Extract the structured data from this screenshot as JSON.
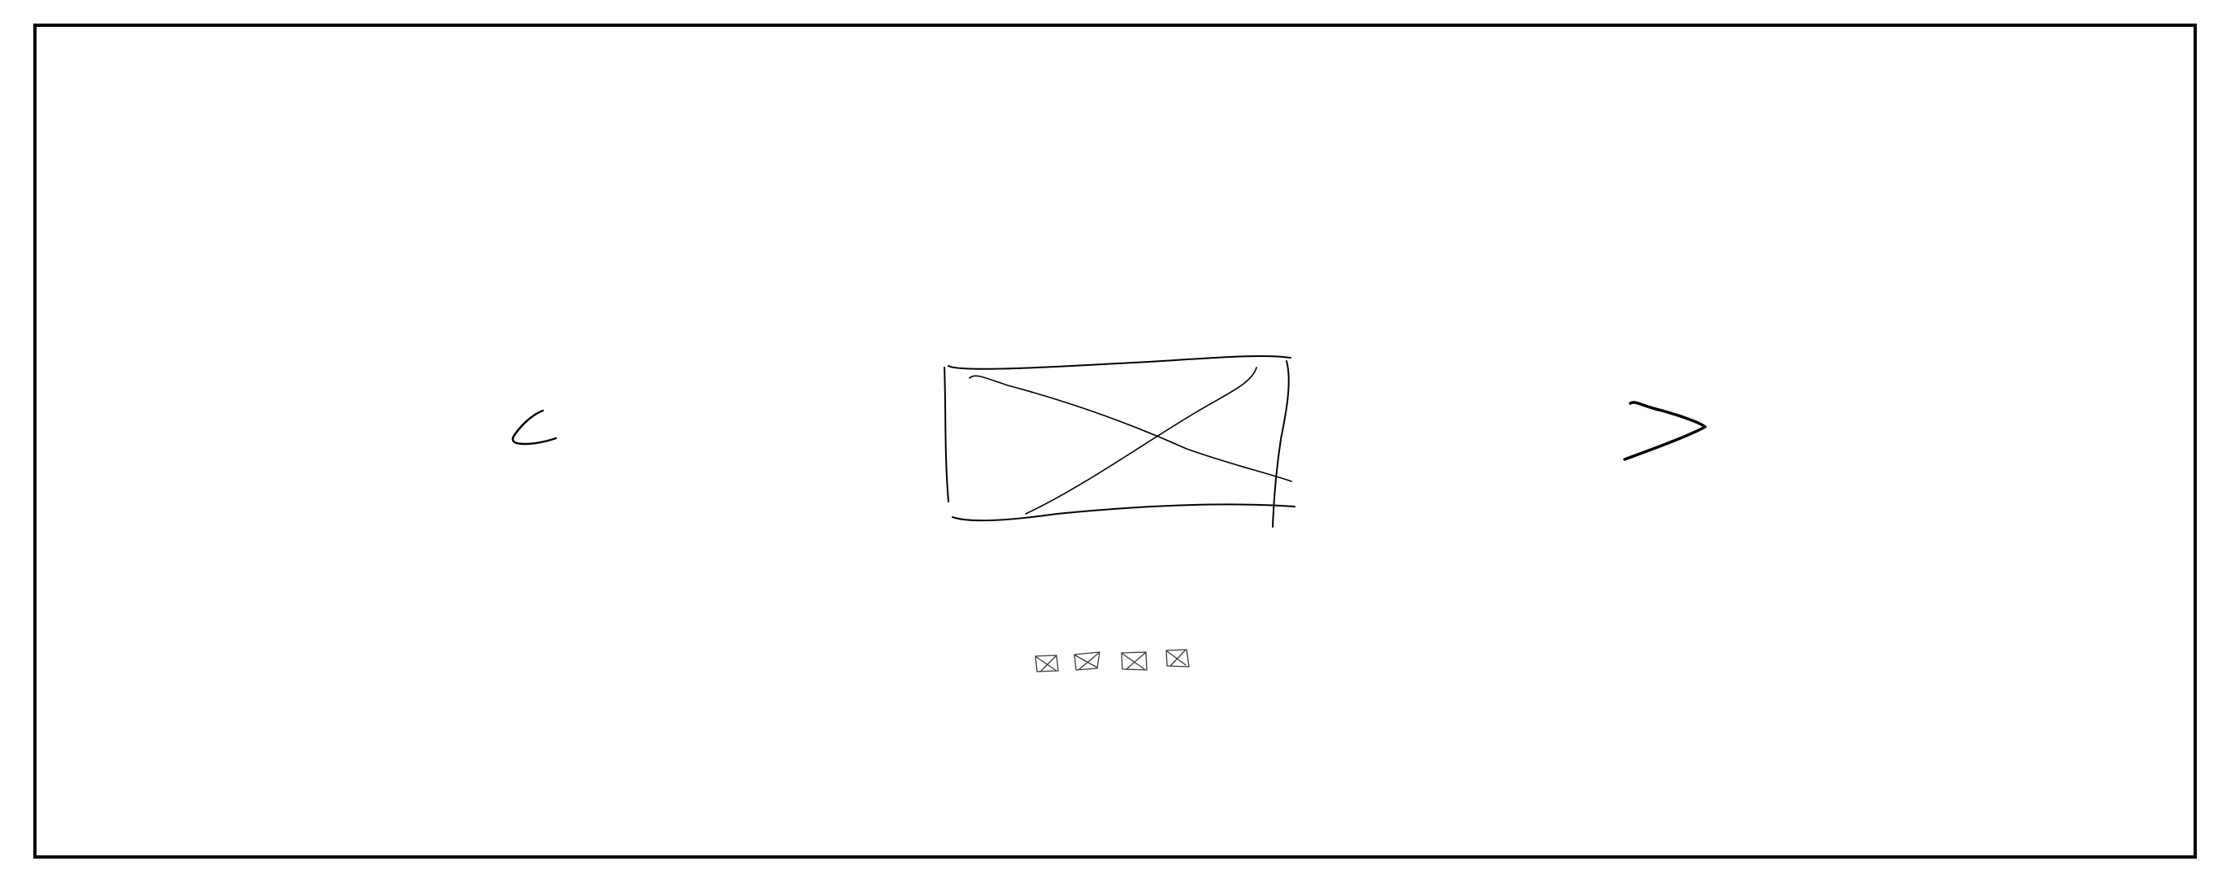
{
  "carousel": {
    "prev_control": {
      "icon": "chevron-left-icon"
    },
    "next_control": {
      "icon": "chevron-right-icon"
    },
    "main_image": {
      "icon": "image-placeholder-icon"
    },
    "indicators": [
      {
        "icon": "image-placeholder-icon"
      },
      {
        "icon": "image-placeholder-icon"
      },
      {
        "icon": "image-placeholder-icon"
      },
      {
        "icon": "image-placeholder-icon"
      }
    ]
  },
  "colors": {
    "stroke": "#000000",
    "background": "#ffffff"
  }
}
